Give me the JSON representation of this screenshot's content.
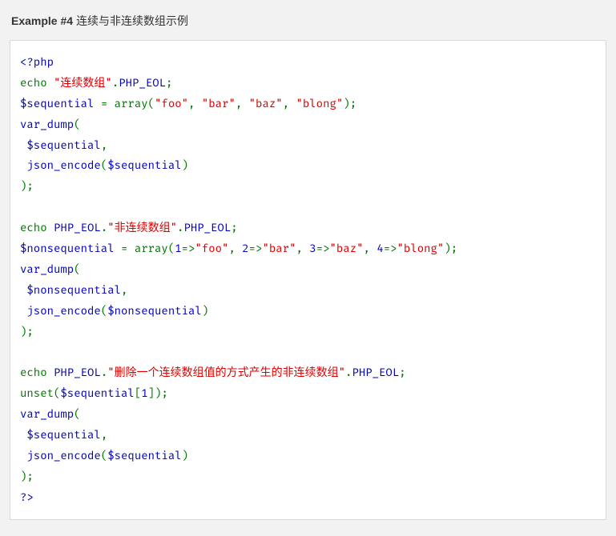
{
  "title_prefix": "Example #4",
  "title_text": "连续与非连续数组示例",
  "code": {
    "open_tag": "<?php",
    "echo": "echo ",
    "str_seq_header": "\"连续数组\"",
    "dot": ".",
    "php_eol": "PHP_EOL",
    "semi": ";",
    "var_sequential": "$sequential ",
    "assign": "= ",
    "array_kw": "array",
    "lparen": "(",
    "rparen": ")",
    "comma_sp": ", ",
    "s_foo": "\"foo\"",
    "s_bar": "\"bar\"",
    "s_baz": "\"baz\"",
    "s_blong": "\"blong\"",
    "var_dump": "var_dump",
    "arg_sequential": " $sequential",
    "comma": ",",
    "json_encode": " json_encode",
    "inner_sequential": "$sequential",
    "str_nonseq_header": "\"非连续数组\"",
    "var_nonsequential": "$nonsequential ",
    "n1": "1",
    "n2": "2",
    "n3": "3",
    "n4": "4",
    "fat_arrow": "=>",
    "arg_nonsequential": " $nonsequential",
    "inner_nonsequential": "$nonsequential",
    "str_unset_header": "\"删除一个连续数组值的方式产生的非连续数组\"",
    "unset": "unset",
    "seq_index": "$sequential",
    "lbracket": "[",
    "idx1": "1",
    "rbracket": "]",
    "close_tag": "?>"
  }
}
